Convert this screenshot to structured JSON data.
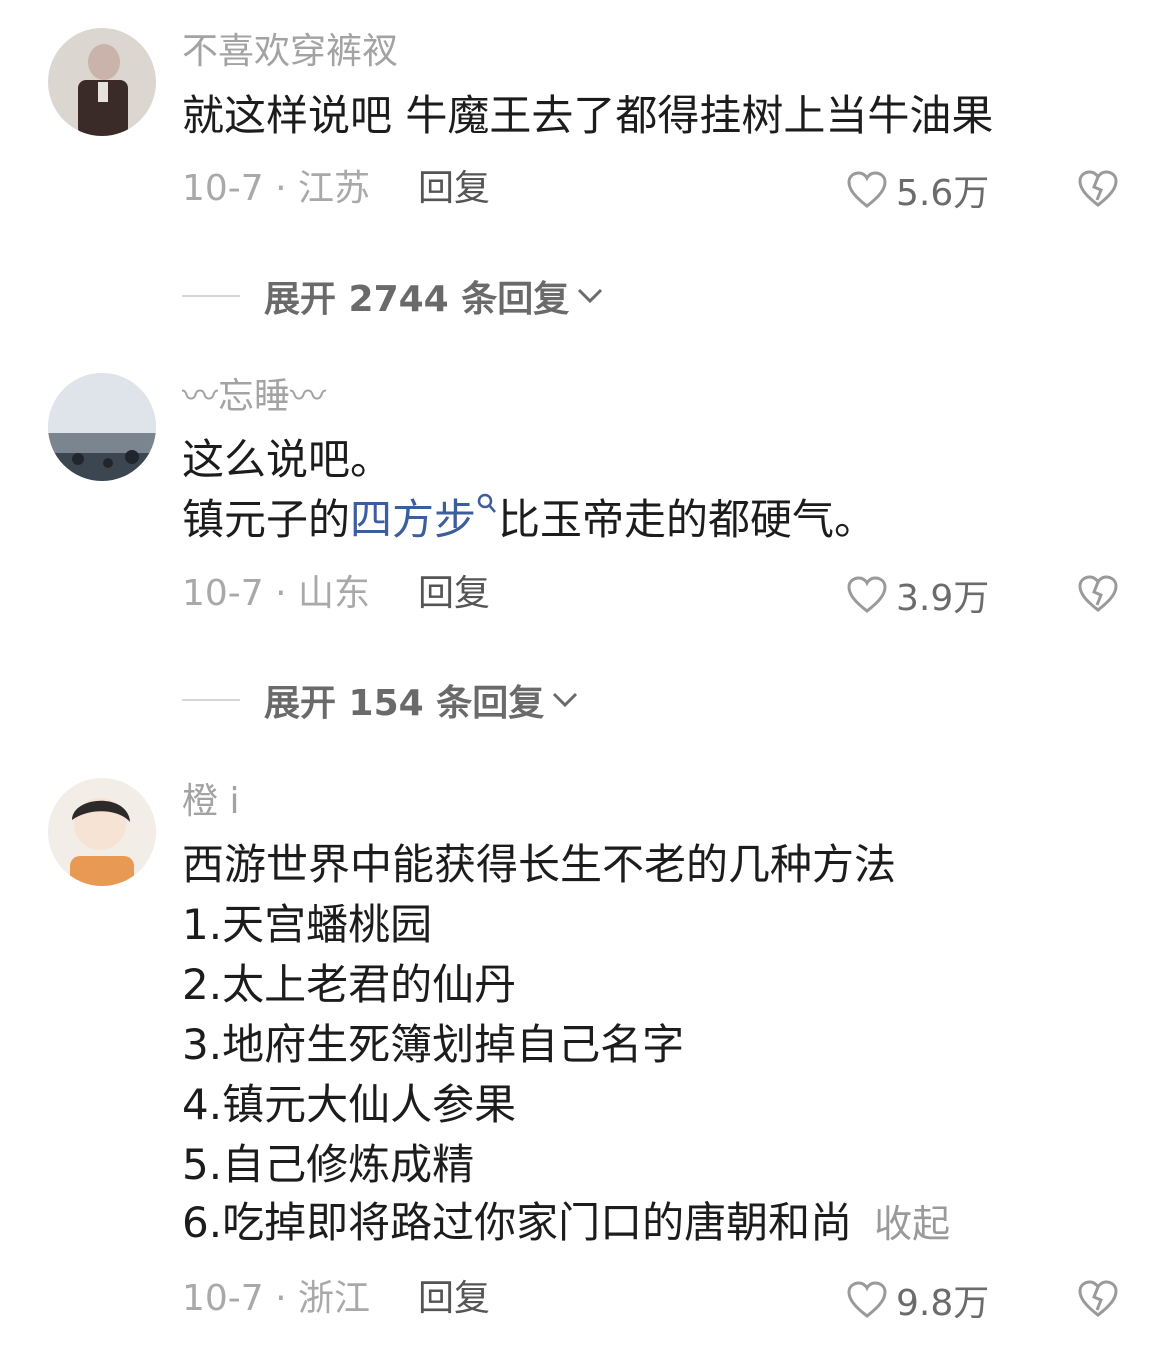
{
  "comments": [
    {
      "username": "不喜欢穿裤衩",
      "lines": [
        "就这样说吧 牛魔王去了都得挂树上当牛油果"
      ],
      "date_location": "10-7 · 江苏",
      "reply_label": "回复",
      "likes": "5.6万",
      "expand_label": "展开 2744 条回复"
    },
    {
      "username": "〰忘睡〰",
      "line1": "这么说吧。",
      "line2_pre": "镇元子的",
      "line2_link": "四方步",
      "line2_post": "比玉帝走的都硬气。",
      "date_location": "10-7 · 山东",
      "reply_label": "回复",
      "likes": "3.9万",
      "expand_label": "展开 154 条回复"
    },
    {
      "username": "橙 i",
      "lines": [
        "西游世界中能获得长生不老的几种方法",
        "1.天宫蟠桃园",
        "2.太上老君的仙丹",
        "3.地府生死簿划掉自己名字",
        "4.镇元大仙人参果",
        "5.自己修炼成精",
        "6.吃掉即将路过你家门口的唐朝和尚"
      ],
      "collapse_label": "收起",
      "date_location": "10-7 · 浙江",
      "reply_label": "回复",
      "likes": "9.8万"
    }
  ],
  "icons": {
    "like": "heart-outline-icon",
    "dislike": "broken-heart-icon",
    "expand": "chevron-down-icon",
    "search": "search-icon"
  },
  "colors": {
    "link": "#3c5d9e",
    "secondary_text": "#a9a9a9"
  }
}
